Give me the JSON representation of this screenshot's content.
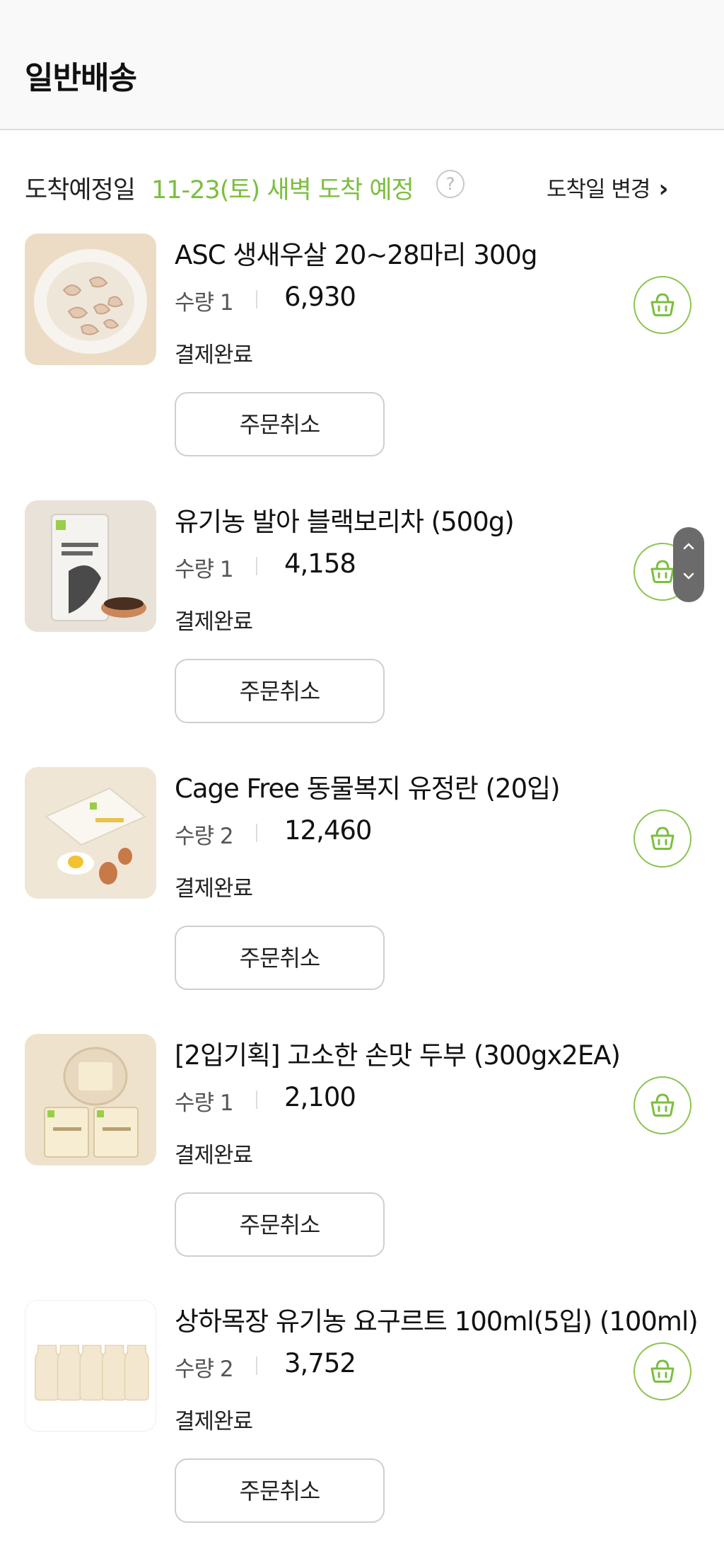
{
  "header": {
    "title": "일반배송"
  },
  "delivery": {
    "label": "도착예정일",
    "date_text": "11-23(토) 새벽 도착 예정",
    "help_icon": "question-icon",
    "change_label": "도착일 변경",
    "accent_color": "#7bbf3e"
  },
  "items": [
    {
      "name": "ASC 생새우살 20~28마리 300g",
      "qty_label": "수량 1",
      "price": "6,930",
      "status": "결제완료",
      "cancel_label": "주문취소",
      "image": "shrimp-bowl"
    },
    {
      "name": "유기농 발아 블랙보리차 (500g)",
      "qty_label": "수량 1",
      "price": "4,158",
      "status": "결제완료",
      "cancel_label": "주문취소",
      "image": "barley-tea-bag"
    },
    {
      "name": "Cage Free 동물복지 유정란 (20입)",
      "qty_label": "수량 2",
      "price": "12,460",
      "status": "결제완료",
      "cancel_label": "주문취소",
      "image": "egg-box"
    },
    {
      "name": "[2입기획] 고소한 손맛 두부 (300gx2EA)",
      "qty_label": "수량 1",
      "price": "2,100",
      "status": "결제완료",
      "cancel_label": "주문취소",
      "image": "tofu-pack"
    },
    {
      "name": "상하목장 유기농 요구르트 100ml(5입) (100ml)",
      "qty_label": "수량 2",
      "price": "3,752",
      "status": "결제완료",
      "cancel_label": "주문취소",
      "image": "yogurt-bottles"
    }
  ],
  "icons": {
    "cart": "shopping-basket-icon",
    "chevron": "chevron-right-icon",
    "scroll": "scroll-up-down-icon"
  },
  "colors": {
    "cart_border": "#8cc450",
    "accent": "#7bbf3e"
  }
}
